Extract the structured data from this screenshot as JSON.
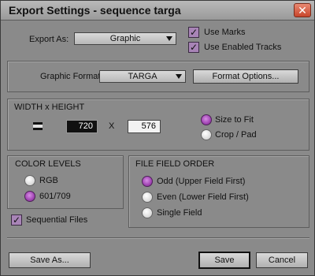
{
  "window": {
    "title": "Export Settings - sequence targa",
    "close_symbol": "✕"
  },
  "export_as": {
    "label": "Export As:",
    "value": "Graphic",
    "use_marks_label": "Use Marks",
    "use_marks_checked": true,
    "use_enabled_tracks_label": "Use Enabled Tracks",
    "use_enabled_tracks_checked": true
  },
  "graphic_format": {
    "label": "Graphic Format:",
    "value": "TARGA",
    "format_options_label": "Format Options..."
  },
  "size": {
    "heading": "WIDTH x HEIGHT",
    "width": "720",
    "x_label": "X",
    "height": "576",
    "size_to_fit_label": "Size to Fit",
    "crop_pad_label": "Crop / Pad",
    "selected": "Size to Fit"
  },
  "color_levels": {
    "heading": "COLOR LEVELS",
    "options": [
      "RGB",
      "601/709"
    ],
    "selected": "601/709"
  },
  "file_field_order": {
    "heading": "FILE FIELD ORDER",
    "options": [
      "Odd (Upper Field First)",
      "Even (Lower Field First)",
      "Single Field"
    ],
    "selected": "Odd (Upper Field First)"
  },
  "sequential_files": {
    "label": "Sequential Files",
    "checked": true
  },
  "footer": {
    "save_as_label": "Save As...",
    "save_label": "Save",
    "cancel_label": "Cancel"
  },
  "colors": {
    "window_bg": "#8a8a8a",
    "accent_purple": "#a144b3"
  }
}
